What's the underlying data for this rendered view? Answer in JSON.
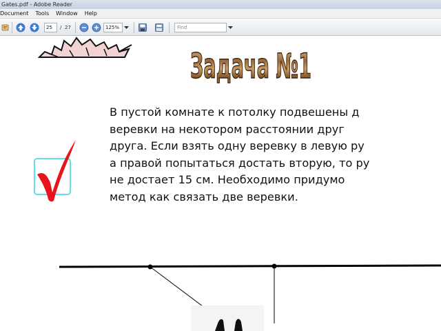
{
  "window": {
    "title": "Gates.pdf - Adobe Reader"
  },
  "menu": {
    "items": [
      "Document",
      "Tools",
      "Window",
      "Help"
    ]
  },
  "toolbar": {
    "page_current": "25",
    "page_separator": "/",
    "page_total": "27",
    "zoom": "125%",
    "find_placeholder": "Find"
  },
  "document": {
    "heading": "Задача №1",
    "paragraph_lines": [
      "В пустой комнате к потолку подвешены д",
      "веревки на некотором расстоянии друг",
      "друга. Если взять одну веревку в левую ру",
      "а правой попытаться достать вторую, то ру",
      "не достает 15 см. Необходимо придумо",
      "метод как связать две веревки."
    ]
  },
  "colors": {
    "checkbox_border": "#5fe0e6",
    "checkmark": "#e8141c",
    "heading_fill": "#9a6b3c"
  }
}
